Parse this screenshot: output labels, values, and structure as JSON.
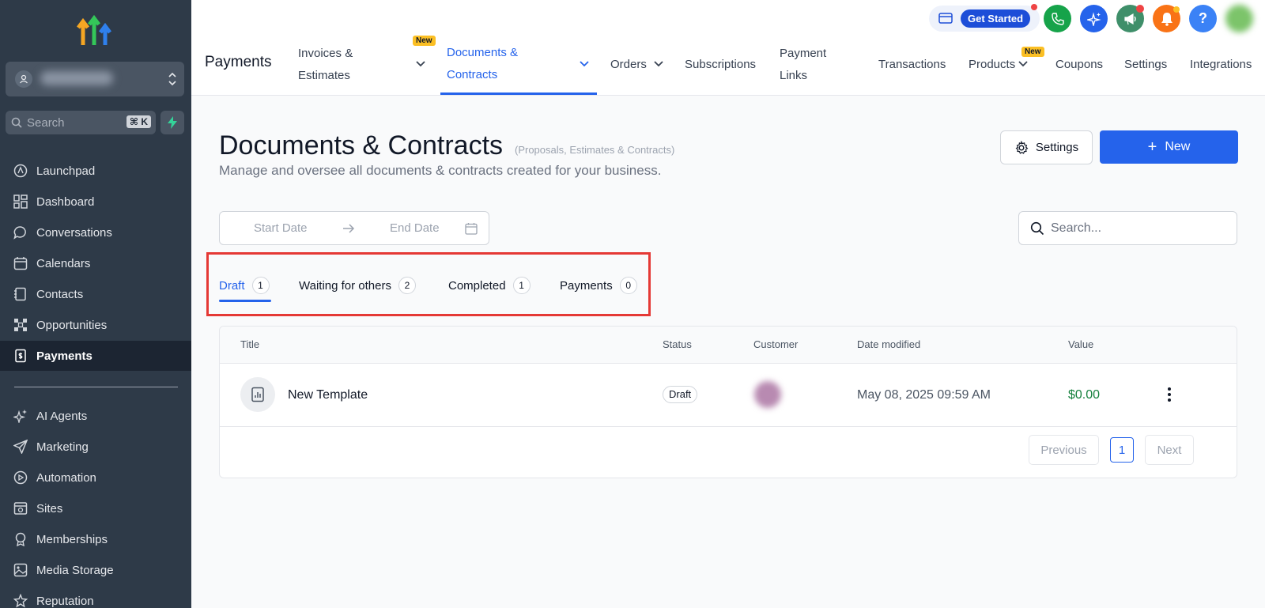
{
  "sidebar": {
    "search_placeholder": "Search",
    "shortcut": "⌘ K",
    "items": [
      {
        "label": "Launchpad",
        "icon": "rocket-icon"
      },
      {
        "label": "Dashboard",
        "icon": "dashboard-icon"
      },
      {
        "label": "Conversations",
        "icon": "chat-icon"
      },
      {
        "label": "Calendars",
        "icon": "calendar-icon"
      },
      {
        "label": "Contacts",
        "icon": "contacts-icon"
      },
      {
        "label": "Opportunities",
        "icon": "opportunities-icon"
      },
      {
        "label": "Payments",
        "icon": "payments-icon",
        "active": true
      },
      {
        "label": "AI Agents",
        "icon": "sparkle-icon"
      },
      {
        "label": "Marketing",
        "icon": "send-icon"
      },
      {
        "label": "Automation",
        "icon": "automation-icon"
      },
      {
        "label": "Sites",
        "icon": "sites-icon"
      },
      {
        "label": "Memberships",
        "icon": "memberships-icon"
      },
      {
        "label": "Media Storage",
        "icon": "image-icon"
      },
      {
        "label": "Reputation",
        "icon": "star-icon"
      }
    ]
  },
  "header": {
    "section_title": "Payments",
    "get_started": "Get Started",
    "new_badge": "New",
    "tabs": [
      {
        "line1": "Invoices &",
        "line2": "Estimates"
      },
      {
        "line1": "Documents &",
        "line2": "Contracts"
      },
      {
        "label": "Orders"
      },
      {
        "label": "Subscriptions"
      },
      {
        "line1": "Payment",
        "line2": "Links"
      },
      {
        "label": "Transactions"
      },
      {
        "label": "Products"
      },
      {
        "label": "Coupons"
      },
      {
        "label": "Settings"
      },
      {
        "label": "Integrations"
      }
    ]
  },
  "page": {
    "title": "Documents & Contracts",
    "title_sub": "(Proposals, Estimates & Contracts)",
    "description": "Manage and oversee all documents & contracts created for your business.",
    "settings_button": "Settings",
    "new_button": "New",
    "start_date": "Start Date",
    "end_date": "End Date",
    "search_placeholder": "Search..."
  },
  "status_tabs": [
    {
      "label": "Draft",
      "count": "1"
    },
    {
      "label": "Waiting for others",
      "count": "2"
    },
    {
      "label": "Completed",
      "count": "1"
    },
    {
      "label": "Payments",
      "count": "0"
    }
  ],
  "table": {
    "columns": [
      "Title",
      "Status",
      "Customer",
      "Date modified",
      "Value"
    ],
    "rows": [
      {
        "title": "New Template",
        "status": "Draft",
        "date": "May 08, 2025 09:59 AM",
        "value": "$0.00"
      }
    ],
    "pager": {
      "previous": "Previous",
      "page": "1",
      "next": "Next"
    }
  },
  "colors": {
    "accent": "#2563eb",
    "sidebar": "#2e3a48",
    "highlight": "#e53935",
    "value": "#15803d"
  }
}
